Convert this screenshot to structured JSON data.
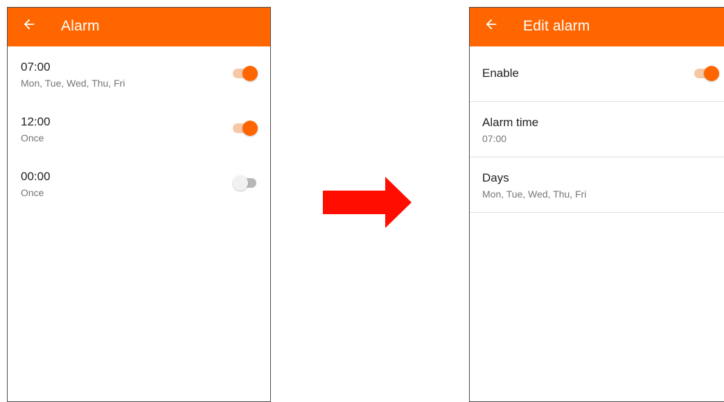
{
  "left_screen": {
    "title": "Alarm",
    "alarms": [
      {
        "time": "07:00",
        "days": "Mon, Tue, Wed, Thu, Fri",
        "enabled": true
      },
      {
        "time": "12:00",
        "days": "Once",
        "enabled": true
      },
      {
        "time": "00:00",
        "days": "Once",
        "enabled": false
      }
    ]
  },
  "right_screen": {
    "title": "Edit alarm",
    "enable_label": "Enable",
    "enable_on": true,
    "alarm_time_label": "Alarm time",
    "alarm_time_value": "07:00",
    "days_label": "Days",
    "days_value": "Mon, Tue, Wed, Thu, Fri"
  },
  "icons": {
    "back": "back-arrow-icon",
    "transition": "right-arrow-icon"
  },
  "colors": {
    "accent": "#ff6600",
    "switch_track_on": "#f7c8a6",
    "switch_track_off": "#b8b8b8",
    "transition_arrow": "#ff0d00"
  }
}
